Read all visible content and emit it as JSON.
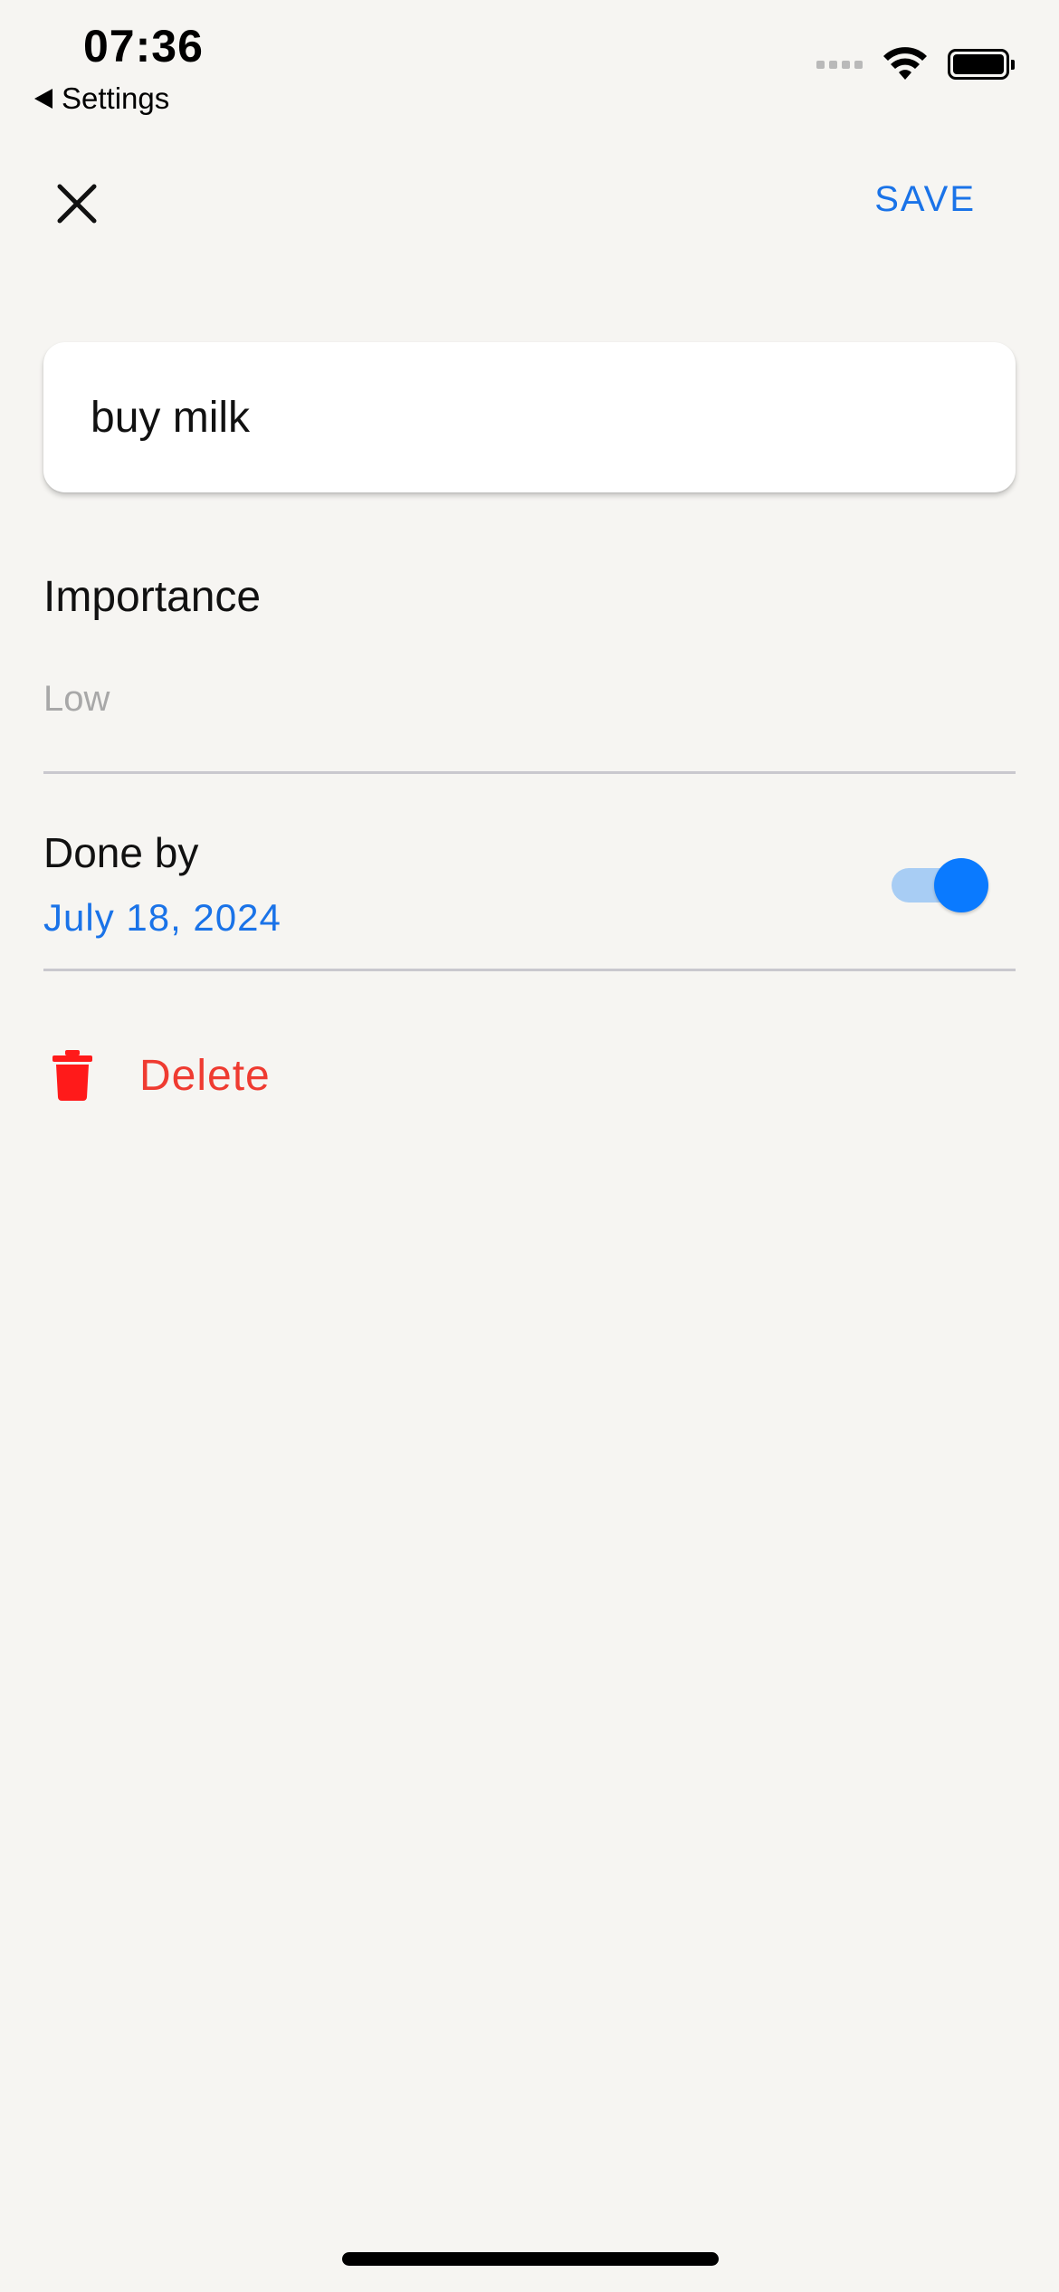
{
  "status_bar": {
    "time": "07:36",
    "back_label": "Settings"
  },
  "toolbar": {
    "save_label": "SAVE"
  },
  "task": {
    "value": "buy milk"
  },
  "importance": {
    "label": "Importance",
    "value": "Low"
  },
  "done_by": {
    "label": "Done by",
    "date": "July 18, 2024",
    "enabled": true
  },
  "delete": {
    "label": "Delete"
  },
  "colors": {
    "accent": "#1a73e8",
    "toggle_on": "#0a7aff",
    "danger": "#ef3b31",
    "background": "#f6f5f2"
  },
  "icons": {
    "close": "close-icon",
    "trash": "trash-icon",
    "wifi": "wifi-icon",
    "battery": "battery-icon",
    "signal": "signal-icon"
  }
}
